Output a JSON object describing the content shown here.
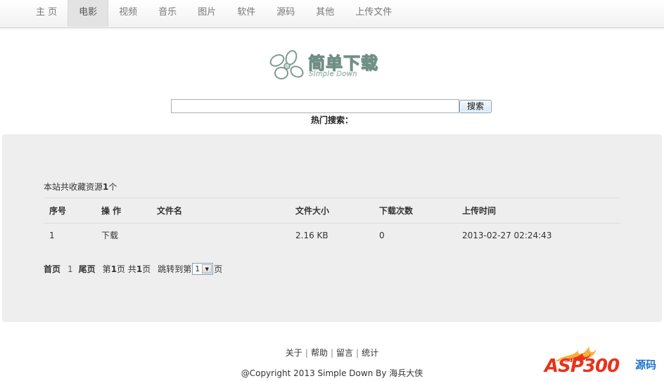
{
  "nav": {
    "items": [
      {
        "label": "主 页"
      },
      {
        "label": "电影"
      },
      {
        "label": "视频"
      },
      {
        "label": "音乐"
      },
      {
        "label": "图片"
      },
      {
        "label": "软件"
      },
      {
        "label": "源码"
      },
      {
        "label": "其他"
      },
      {
        "label": "上传文件"
      }
    ],
    "active_index": 1
  },
  "logo": {
    "title": "简单下载",
    "subtitle": "Simple Down"
  },
  "search": {
    "value": "",
    "button_label": "搜索",
    "hot_label": "热门搜索："
  },
  "summary": {
    "prefix": "本站共收藏资源",
    "count": "1",
    "suffix": "个"
  },
  "table": {
    "headers": [
      "序号",
      "操 作",
      "文件名",
      "文件大小",
      "下载次数",
      "上传时间"
    ],
    "rows": [
      {
        "no": "1",
        "action": "下载",
        "name": "",
        "size": "2.16 KB",
        "downloads": "0",
        "time": "2013-02-27 02:24:43"
      }
    ]
  },
  "pager": {
    "first": "首页",
    "current": "1",
    "last": "尾页",
    "page_info_1": "第",
    "page_no": "1",
    "page_info_2": "页 共",
    "page_total": "1",
    "page_info_3": "页",
    "jump_prefix": "跳转到第",
    "jump_value": "1",
    "jump_suffix": "页"
  },
  "footer": {
    "links": [
      "关于",
      "帮助",
      "留言",
      "统计"
    ],
    "copyright": "@Copyright 2013 Simple Down By 海兵大侠"
  },
  "watermark": {
    "text": "ASP300",
    "sub": "源码"
  },
  "colors": {
    "panel_bg": "#eeeeee",
    "nav_active_bg": "#e3e3e3",
    "watermark_red": "#e8331c",
    "watermark_blue": "#1c72c9"
  }
}
